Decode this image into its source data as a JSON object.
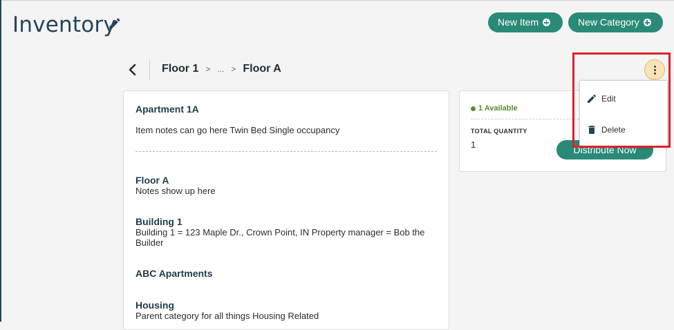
{
  "header": {
    "title": "Inventory",
    "new_item_label": "New Item",
    "new_category_label": "New Category"
  },
  "breadcrumb": {
    "first": "Floor 1",
    "ellipsis": "...",
    "current": "Floor A"
  },
  "item": {
    "name": "Apartment 1A",
    "notes": "Item notes can go here Twin Bed Single occupancy"
  },
  "hierarchy": [
    {
      "name": "Floor A",
      "notes": "Notes show up here"
    },
    {
      "name": "Building 1",
      "notes": "Building 1 = 123 Maple Dr., Crown Point, IN Property manager = Bob the Builder"
    },
    {
      "name": "ABC Apartments",
      "notes": ""
    },
    {
      "name": "Housing",
      "notes": "Parent category for all things Housing Related"
    }
  ],
  "summary": {
    "available_text": "1 Available",
    "total_quantity_label": "TOTAL QUANTITY",
    "total_quantity_value": "1",
    "distribute_label": "Distribute Now"
  },
  "menu": {
    "edit_label": "Edit",
    "delete_label": "Delete"
  },
  "colors": {
    "primary": "#2a8a78",
    "heading": "#24445c",
    "available": "#5c8a2f",
    "highlight": "#e0202a",
    "more_button": "#fbe3b6"
  },
  "icons": [
    "pencil-icon",
    "plus-circle-icon",
    "chevron-left-icon",
    "more-vertical-icon",
    "trash-icon"
  ]
}
